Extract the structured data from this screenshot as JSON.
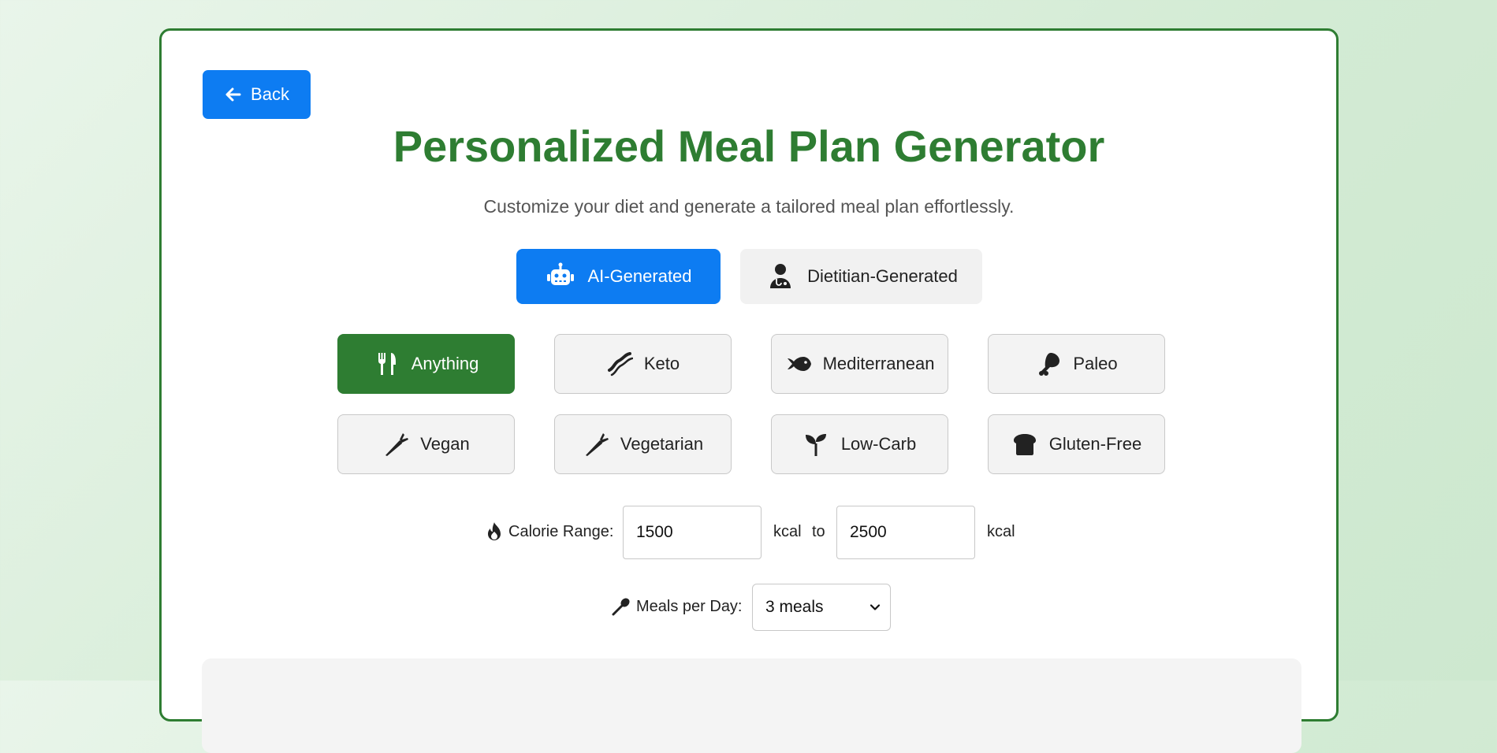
{
  "back_button": {
    "label": "Back",
    "icon": "arrow-left-icon"
  },
  "title": "Personalized Meal Plan Generator",
  "subtitle": "Customize your diet and generate a tailored meal plan effortlessly.",
  "modes": [
    {
      "label": "AI-Generated",
      "icon": "robot-icon",
      "active": true
    },
    {
      "label": "Dietitian-Generated",
      "icon": "doctor-icon",
      "active": false
    }
  ],
  "diets": [
    {
      "label": "Anything",
      "icon": "utensils-icon",
      "active": true
    },
    {
      "label": "Keto",
      "icon": "bacon-icon",
      "active": false
    },
    {
      "label": "Mediterranean",
      "icon": "fish-icon",
      "active": false
    },
    {
      "label": "Paleo",
      "icon": "drumstick-icon",
      "active": false
    },
    {
      "label": "Vegan",
      "icon": "carrot-icon",
      "active": false
    },
    {
      "label": "Vegetarian",
      "icon": "carrot-icon",
      "active": false
    },
    {
      "label": "Low-Carb",
      "icon": "seedling-icon",
      "active": false
    },
    {
      "label": "Gluten-Free",
      "icon": "bread-icon",
      "active": false
    }
  ],
  "calorie": {
    "label": "Calorie Range:",
    "icon": "fire-icon",
    "min": "1500",
    "max": "2500",
    "unit": "kcal",
    "to": "to"
  },
  "meals": {
    "label": "Meals per Day:",
    "icon": "spoon-icon",
    "selected": "3 meals"
  },
  "colors": {
    "primary_blue": "#0d7cf2",
    "brand_green": "#2e7d32",
    "inactive_gray": "#f3f3f3"
  }
}
